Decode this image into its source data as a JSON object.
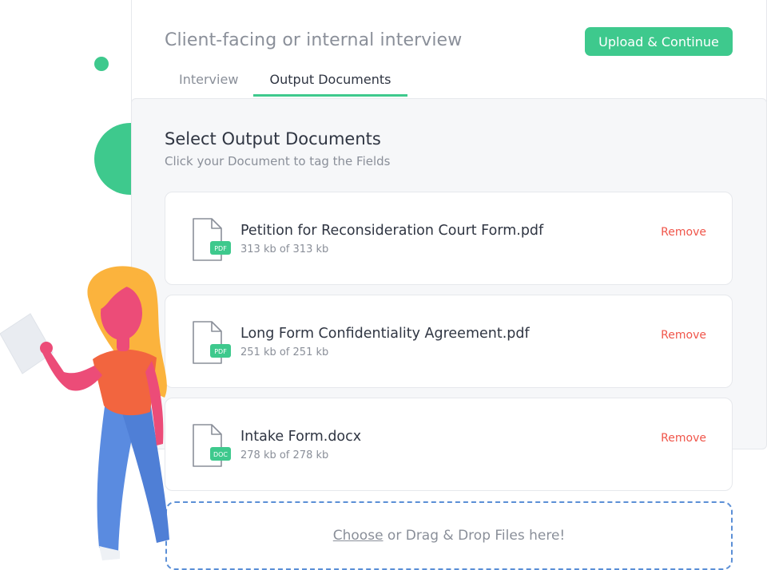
{
  "header": {
    "title": "Client-facing or internal interview",
    "primary_button": "Upload & Continue",
    "tabs": [
      {
        "label": "Interview",
        "active": false
      },
      {
        "label": "Output Documents",
        "active": true
      }
    ]
  },
  "panel": {
    "title": "Select Output Documents",
    "subtitle": "Click your Document to tag the Fields"
  },
  "files": [
    {
      "name": "Petition for Reconsideration Court Form.pdf",
      "size": "313 kb of 313 kb",
      "type_badge": "PDF",
      "action": "Remove"
    },
    {
      "name": "Long Form Confidentiality Agreement.pdf",
      "size": "251 kb of 251 kb",
      "type_badge": "PDF",
      "action": "Remove"
    },
    {
      "name": "Intake Form.docx",
      "size": "278 kb of 278 kb",
      "type_badge": "DOC",
      "action": "Remove"
    }
  ],
  "dropzone": {
    "choose_label": "Choose",
    "rest_label": " or Drag & Drop Files here!"
  },
  "colors": {
    "accent": "#3ec98d",
    "danger": "#f0554a",
    "dropzone_border": "#5b8fd6",
    "muted_text": "#8a8f99"
  }
}
